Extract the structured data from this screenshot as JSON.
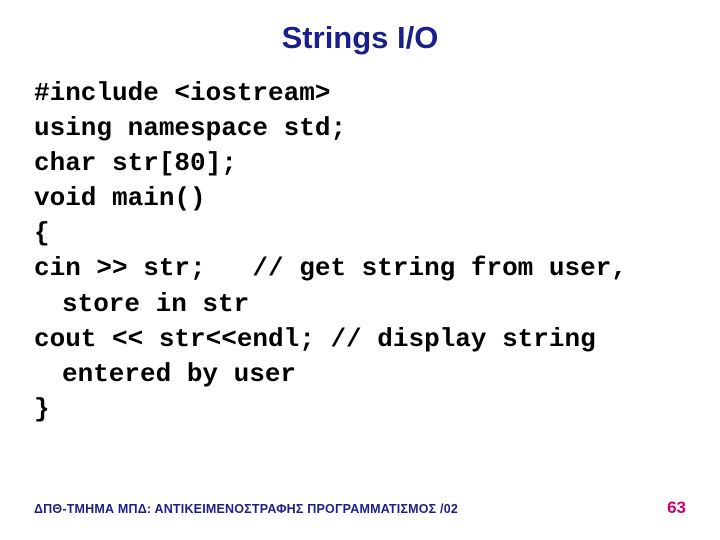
{
  "title": "Strings I/O",
  "code": {
    "lines": [
      "#include <iostream>",
      "using namespace std;",
      "char str[80];",
      "void main()",
      "{",
      "cin >> str;   // get string from user, store in str",
      "cout << str<<endl; // display string entered by user",
      "}"
    ]
  },
  "footer": {
    "left": "ΔΠΘ-ΤΜΗΜΑ ΜΠΔ: ΑΝΤΙΚΕΙΜΕΝΟΣΤΡΑΦΗΣ ΠΡΟΓΡΑΜΜΑΤΙΣΜΟΣ /02",
    "page": "63"
  }
}
